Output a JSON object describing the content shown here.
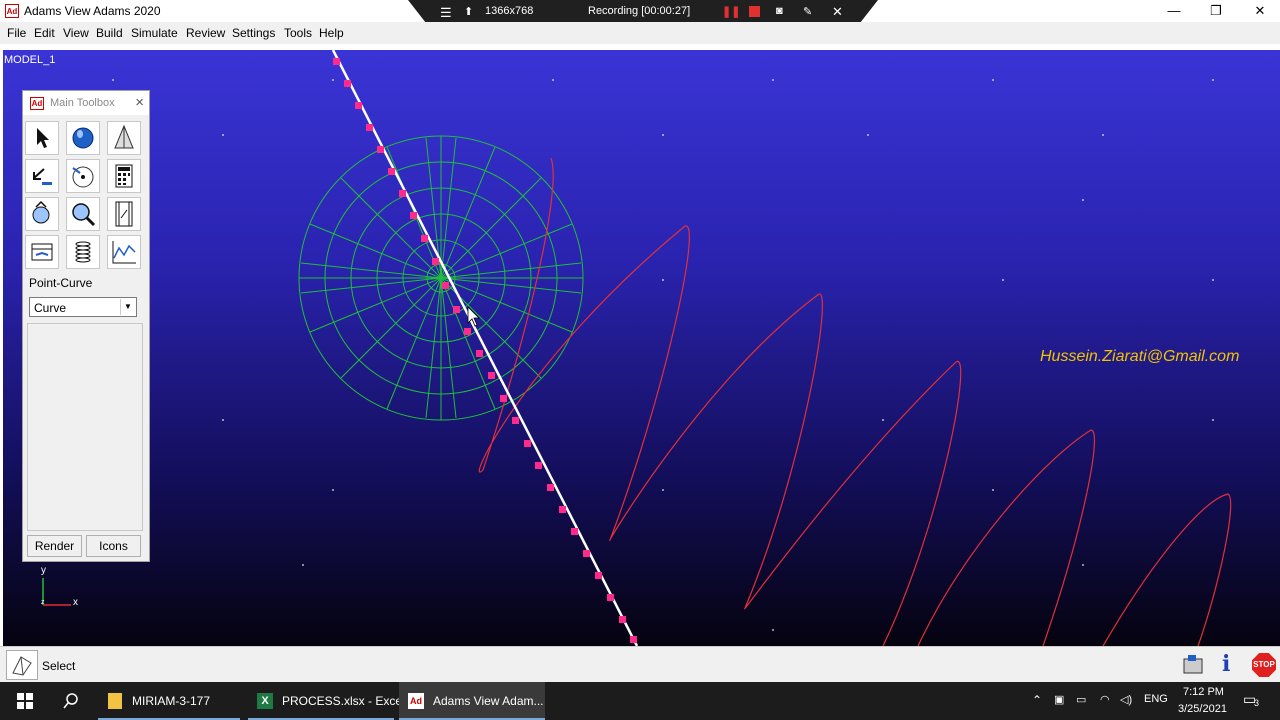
{
  "window": {
    "title": "Adams View Adams 2020",
    "app_badge": "Ad",
    "minimize": "—",
    "maximize": "❐",
    "close": "✕"
  },
  "recorder": {
    "resolution": "1366x768",
    "status": "Recording [00:00:27]"
  },
  "menu": [
    "File",
    "Edit",
    "View",
    "Build",
    "Simulate",
    "Review",
    "Settings",
    "Tools",
    "Help"
  ],
  "viewport": {
    "model_label": "MODEL_1",
    "watermark": "Hussein.Ziarati@Gmail.com",
    "axis_x": "x",
    "axis_y": "y",
    "axis_z": "z",
    "bg_top": "#3a34d6",
    "bg_bottom": "#05030f",
    "curve_color": "#e0303a",
    "mesh_color": "#1fbf3a",
    "marker_color": "#ff2a8c"
  },
  "toolbox": {
    "title": "Main Toolbox",
    "badge": "Ad",
    "tools": [
      "select-arrow-icon",
      "sphere-icon",
      "cone-icon",
      "undo-icon",
      "rotate-view-icon",
      "calculator-icon",
      "part-icon",
      "zoom-icon",
      "film-icon",
      "table-icon",
      "spring-icon",
      "plot-icon"
    ],
    "label": "Point-Curve",
    "dropdown_value": "Curve",
    "render_button": "Render",
    "icons_button": "Icons"
  },
  "statusbar": {
    "text": "Select"
  },
  "taskbar": {
    "items": [
      {
        "label": "MIRIAM-3-177",
        "icon": "folder-icon"
      },
      {
        "label": "PROCESS.xlsx - Excel",
        "icon": "excel-icon"
      },
      {
        "label": "Adams View Adam...",
        "icon": "adams-icon"
      }
    ],
    "lang": "ENG",
    "time": "7:12 PM",
    "date": "3/25/2021",
    "notifications": "3"
  }
}
